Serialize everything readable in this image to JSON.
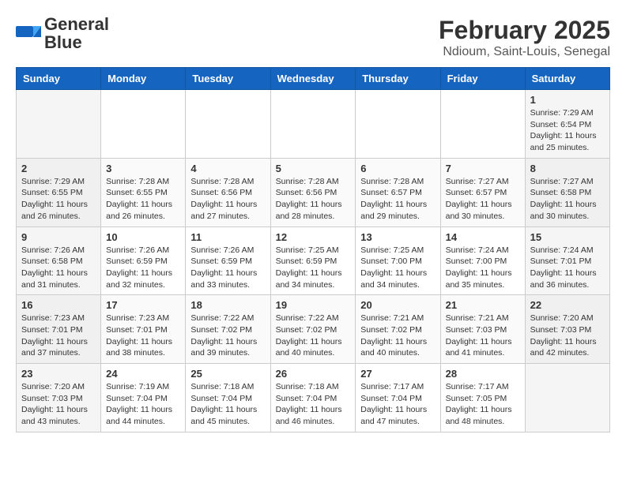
{
  "app": {
    "logo_general": "General",
    "logo_blue": "Blue",
    "title": "February 2025",
    "subtitle": "Ndioum, Saint-Louis, Senegal"
  },
  "calendar": {
    "headers": [
      "Sunday",
      "Monday",
      "Tuesday",
      "Wednesday",
      "Thursday",
      "Friday",
      "Saturday"
    ],
    "weeks": [
      {
        "days": [
          {
            "num": "",
            "info": ""
          },
          {
            "num": "",
            "info": ""
          },
          {
            "num": "",
            "info": ""
          },
          {
            "num": "",
            "info": ""
          },
          {
            "num": "",
            "info": ""
          },
          {
            "num": "",
            "info": ""
          },
          {
            "num": "1",
            "info": "Sunrise: 7:29 AM\nSunset: 6:54 PM\nDaylight: 11 hours and 25 minutes."
          }
        ]
      },
      {
        "days": [
          {
            "num": "2",
            "info": "Sunrise: 7:29 AM\nSunset: 6:55 PM\nDaylight: 11 hours and 26 minutes."
          },
          {
            "num": "3",
            "info": "Sunrise: 7:28 AM\nSunset: 6:55 PM\nDaylight: 11 hours and 26 minutes."
          },
          {
            "num": "4",
            "info": "Sunrise: 7:28 AM\nSunset: 6:56 PM\nDaylight: 11 hours and 27 minutes."
          },
          {
            "num": "5",
            "info": "Sunrise: 7:28 AM\nSunset: 6:56 PM\nDaylight: 11 hours and 28 minutes."
          },
          {
            "num": "6",
            "info": "Sunrise: 7:28 AM\nSunset: 6:57 PM\nDaylight: 11 hours and 29 minutes."
          },
          {
            "num": "7",
            "info": "Sunrise: 7:27 AM\nSunset: 6:57 PM\nDaylight: 11 hours and 30 minutes."
          },
          {
            "num": "8",
            "info": "Sunrise: 7:27 AM\nSunset: 6:58 PM\nDaylight: 11 hours and 30 minutes."
          }
        ]
      },
      {
        "days": [
          {
            "num": "9",
            "info": "Sunrise: 7:26 AM\nSunset: 6:58 PM\nDaylight: 11 hours and 31 minutes."
          },
          {
            "num": "10",
            "info": "Sunrise: 7:26 AM\nSunset: 6:59 PM\nDaylight: 11 hours and 32 minutes."
          },
          {
            "num": "11",
            "info": "Sunrise: 7:26 AM\nSunset: 6:59 PM\nDaylight: 11 hours and 33 minutes."
          },
          {
            "num": "12",
            "info": "Sunrise: 7:25 AM\nSunset: 6:59 PM\nDaylight: 11 hours and 34 minutes."
          },
          {
            "num": "13",
            "info": "Sunrise: 7:25 AM\nSunset: 7:00 PM\nDaylight: 11 hours and 34 minutes."
          },
          {
            "num": "14",
            "info": "Sunrise: 7:24 AM\nSunset: 7:00 PM\nDaylight: 11 hours and 35 minutes."
          },
          {
            "num": "15",
            "info": "Sunrise: 7:24 AM\nSunset: 7:01 PM\nDaylight: 11 hours and 36 minutes."
          }
        ]
      },
      {
        "days": [
          {
            "num": "16",
            "info": "Sunrise: 7:23 AM\nSunset: 7:01 PM\nDaylight: 11 hours and 37 minutes."
          },
          {
            "num": "17",
            "info": "Sunrise: 7:23 AM\nSunset: 7:01 PM\nDaylight: 11 hours and 38 minutes."
          },
          {
            "num": "18",
            "info": "Sunrise: 7:22 AM\nSunset: 7:02 PM\nDaylight: 11 hours and 39 minutes."
          },
          {
            "num": "19",
            "info": "Sunrise: 7:22 AM\nSunset: 7:02 PM\nDaylight: 11 hours and 40 minutes."
          },
          {
            "num": "20",
            "info": "Sunrise: 7:21 AM\nSunset: 7:02 PM\nDaylight: 11 hours and 40 minutes."
          },
          {
            "num": "21",
            "info": "Sunrise: 7:21 AM\nSunset: 7:03 PM\nDaylight: 11 hours and 41 minutes."
          },
          {
            "num": "22",
            "info": "Sunrise: 7:20 AM\nSunset: 7:03 PM\nDaylight: 11 hours and 42 minutes."
          }
        ]
      },
      {
        "days": [
          {
            "num": "23",
            "info": "Sunrise: 7:20 AM\nSunset: 7:03 PM\nDaylight: 11 hours and 43 minutes."
          },
          {
            "num": "24",
            "info": "Sunrise: 7:19 AM\nSunset: 7:04 PM\nDaylight: 11 hours and 44 minutes."
          },
          {
            "num": "25",
            "info": "Sunrise: 7:18 AM\nSunset: 7:04 PM\nDaylight: 11 hours and 45 minutes."
          },
          {
            "num": "26",
            "info": "Sunrise: 7:18 AM\nSunset: 7:04 PM\nDaylight: 11 hours and 46 minutes."
          },
          {
            "num": "27",
            "info": "Sunrise: 7:17 AM\nSunset: 7:04 PM\nDaylight: 11 hours and 47 minutes."
          },
          {
            "num": "28",
            "info": "Sunrise: 7:17 AM\nSunset: 7:05 PM\nDaylight: 11 hours and 48 minutes."
          },
          {
            "num": "",
            "info": ""
          }
        ]
      }
    ]
  }
}
